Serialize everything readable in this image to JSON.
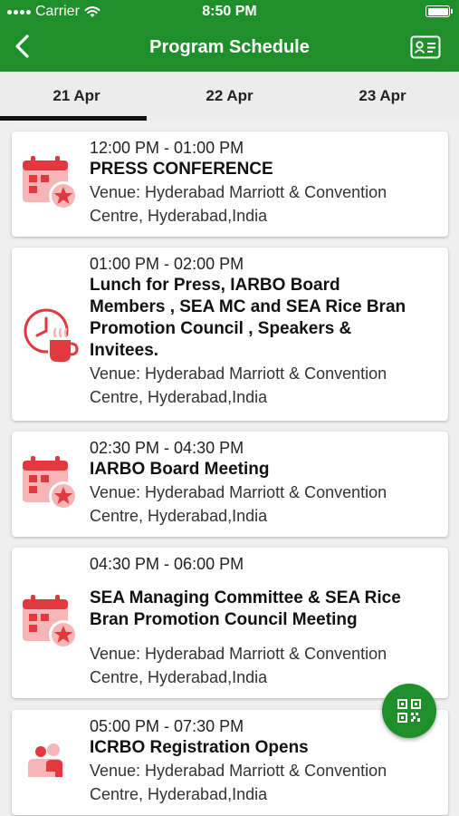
{
  "status_bar": {
    "carrier": "Carrier",
    "time": "8:50 PM"
  },
  "nav": {
    "title": "Program Schedule"
  },
  "tabs": [
    {
      "label": "21 Apr"
    },
    {
      "label": "22 Apr"
    },
    {
      "label": "23 Apr"
    }
  ],
  "selected_tab": "21 Apr",
  "events": [
    {
      "time": "12:00 PM - 01:00 PM",
      "title": "PRESS CONFERENCE",
      "venue_line1": "Venue: Hyderabad Marriott & Convention",
      "venue_line2": "Centre, Hyderabad,India",
      "icon": "calendar-star-icon"
    },
    {
      "time": "01:00 PM - 02:00 PM",
      "title_lines": [
        "Lunch for Press, IARBO Board",
        "Members , SEA MC and SEA Rice Bran",
        "Promotion Council , Speakers &",
        "Invitees."
      ],
      "venue_line1": "Venue: Hyderabad Marriott & Convention",
      "venue_line2": "Centre, Hyderabad,India",
      "icon": "clock-cup-icon"
    },
    {
      "time": "02:30 PM - 04:30 PM",
      "title": "IARBO Board Meeting",
      "venue_line1": "Venue: Hyderabad Marriott & Convention",
      "venue_line2": "Centre, Hyderabad,India",
      "icon": "calendar-star-icon"
    },
    {
      "time": "04:30 PM - 06:00 PM",
      "title_lines": [
        "SEA Managing Committee & SEA Rice",
        "Bran Promotion Council Meeting"
      ],
      "venue_line1": "Venue: Hyderabad Marriott & Convention",
      "venue_line2": "Centre, Hyderabad,India",
      "icon": "calendar-star-icon"
    },
    {
      "time": "05:00 PM - 07:30 PM",
      "title": "ICRBO Registration Opens",
      "venue_line1": "Venue: Hyderabad Marriott & Convention",
      "venue_line2": "Centre, Hyderabad,India",
      "icon": "registration-people-icon"
    }
  ],
  "colors": {
    "primary": "#1f8f2c",
    "icon_red": "#e03a3e",
    "icon_pink": "#f6b6b8"
  }
}
